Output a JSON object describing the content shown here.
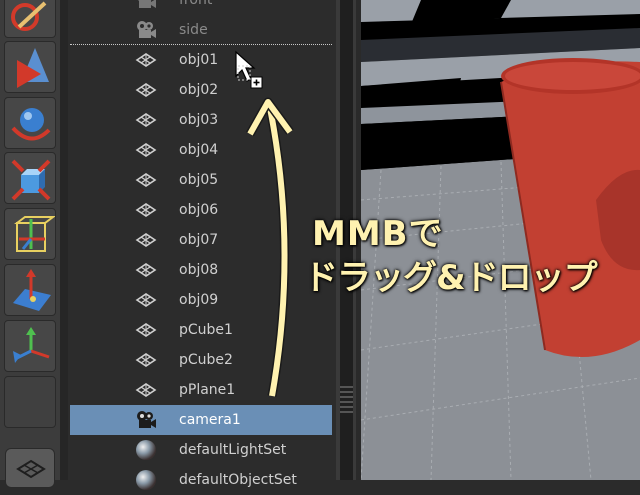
{
  "outliner": {
    "items": [
      {
        "label": "front",
        "icon": "camera-icon",
        "state": "dim"
      },
      {
        "label": "side",
        "icon": "camera-icon",
        "state": "dim"
      },
      {
        "label": "obj01",
        "icon": "transform-icon",
        "state": "normal"
      },
      {
        "label": "obj02",
        "icon": "transform-icon",
        "state": "normal"
      },
      {
        "label": "obj03",
        "icon": "transform-icon",
        "state": "normal"
      },
      {
        "label": "obj04",
        "icon": "transform-icon",
        "state": "normal"
      },
      {
        "label": "obj05",
        "icon": "transform-icon",
        "state": "normal"
      },
      {
        "label": "obj06",
        "icon": "transform-icon",
        "state": "normal"
      },
      {
        "label": "obj07",
        "icon": "transform-icon",
        "state": "normal"
      },
      {
        "label": "obj08",
        "icon": "transform-icon",
        "state": "normal"
      },
      {
        "label": "obj09",
        "icon": "transform-icon",
        "state": "normal"
      },
      {
        "label": "pCube1",
        "icon": "transform-icon",
        "state": "normal"
      },
      {
        "label": "pCube2",
        "icon": "transform-icon",
        "state": "normal"
      },
      {
        "label": "pPlane1",
        "icon": "transform-icon",
        "state": "normal"
      },
      {
        "label": "camera1",
        "icon": "camera-icon",
        "state": "selected"
      },
      {
        "label": "defaultLightSet",
        "icon": "set-icon",
        "state": "normal"
      },
      {
        "label": "defaultObjectSet",
        "icon": "set-icon",
        "state": "normal"
      }
    ]
  },
  "annotation": {
    "line1": "MMBで",
    "line2": "ドラッグ&ドロップ",
    "color": "#fff2b0"
  },
  "colors": {
    "selected_row": "#6a8fb6",
    "object_red": "#c24032"
  },
  "shelf": {
    "tools": [
      "paint-tool-icon",
      "cone-tool-icon",
      "rotate-tool-icon",
      "scale-tool-icon",
      "universal-manipulator-icon",
      "soft-modify-icon",
      "show-manipulator-icon",
      "empty-slot",
      "outliner-toggle-icon"
    ]
  }
}
